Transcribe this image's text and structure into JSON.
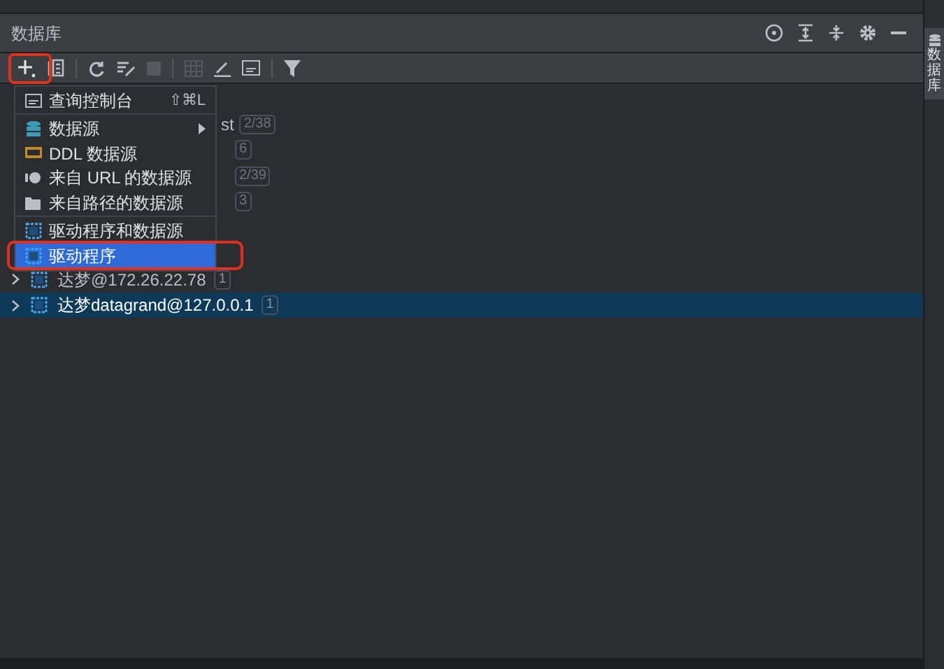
{
  "panel": {
    "title": "数据库",
    "side_tab": "数据库"
  },
  "tree": [
    {
      "kind": "fragment",
      "name": "st",
      "badge": "2/38",
      "selected": false
    },
    {
      "kind": "fragment",
      "badge": "6",
      "selected": false
    },
    {
      "kind": "fragment",
      "badge": "2/39",
      "selected": false
    },
    {
      "kind": "fragment",
      "badge": "3",
      "selected": false
    },
    {
      "kind": "node",
      "name": "达梦@172.26.22.78",
      "badge": "1",
      "selected": false
    },
    {
      "kind": "node",
      "name": "达梦datagrand@127.0.0.1",
      "badge": "1",
      "selected": true
    }
  ],
  "menu": [
    {
      "kind": "item",
      "label": "查询控制台",
      "shortcut": "⇧⌘L",
      "selected": false
    },
    {
      "kind": "separator"
    },
    {
      "kind": "item",
      "label": "数据源",
      "submenu": true,
      "selected": false
    },
    {
      "kind": "item",
      "label": "DDL 数据源",
      "selected": false
    },
    {
      "kind": "item",
      "label": "来自 URL 的数据源",
      "selected": false
    },
    {
      "kind": "item",
      "label": "来自路径的数据源",
      "selected": false
    },
    {
      "kind": "separator"
    },
    {
      "kind": "item",
      "label": "驱动程序和数据源",
      "selected": false
    },
    {
      "kind": "item",
      "label": "驱动程序",
      "selected": true
    }
  ]
}
